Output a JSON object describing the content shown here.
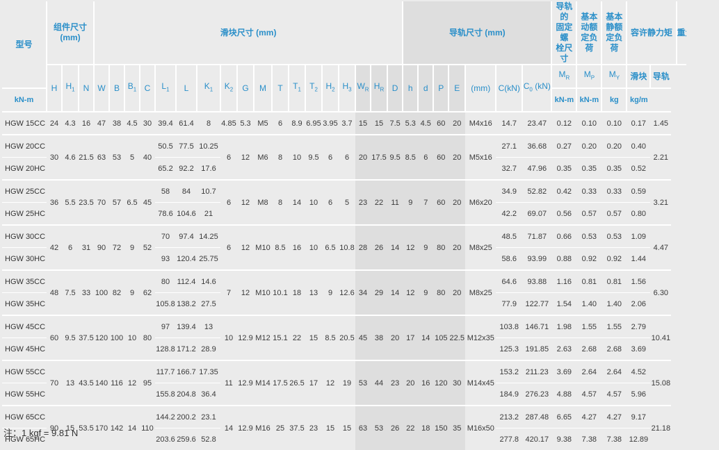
{
  "headers": {
    "model": "型号",
    "assembly": "组件尺寸\n(mm)",
    "block": "滑块尺寸 (mm)",
    "rail": "导轨尺寸 (mm)",
    "rail_bolt": "导轨的\n固定螺\n栓尺寸",
    "dynamic": "基本\n动额\n定负荷",
    "static": "基本\n静额\n定负荷",
    "moment": "容许静力矩",
    "weight": "重量",
    "mr": "MR",
    "mp": "MP",
    "my": "MY",
    "w_block": "滑块",
    "w_rail": "导轨"
  },
  "subheaders": {
    "H": "H",
    "H1": "H1",
    "N": "N",
    "W": "W",
    "B": "B",
    "B1": "B1",
    "C": "C",
    "L1": "L1",
    "L": "L",
    "K1": "K1",
    "K2": "K2",
    "G": "G",
    "M": "M",
    "T": "T",
    "T1": "T1",
    "T2": "T2",
    "H2": "H2",
    "H3": "H3",
    "WR": "WR",
    "HR": "HR",
    "D": "D",
    "h": "h",
    "d": "d",
    "P": "P",
    "E": "E",
    "mm": "(mm)",
    "ckn": "C(kN)",
    "c0kn": "C0 (kN)",
    "knm1": "kN-m",
    "knm2": "kN-m",
    "knm3": "kN-m",
    "kg": "kg",
    "kgm": "kg/m"
  },
  "rows": [
    {
      "model": "HGW 15CC"
    },
    {
      "model": "HGW 20CC"
    },
    {
      "model": "HGW 20HC"
    },
    {
      "model": "HGW 25CC"
    },
    {
      "model": "HGW 25HC"
    },
    {
      "model": "HGW 30CC"
    },
    {
      "model": "HGW 30HC"
    },
    {
      "model": "HGW 35CC"
    },
    {
      "model": "HGW 35HC"
    },
    {
      "model": "HGW 45CC"
    },
    {
      "model": "HGW 45HC"
    },
    {
      "model": "HGW 55CC"
    },
    {
      "model": "HGW 55HC"
    },
    {
      "model": "HGW 65CC"
    },
    {
      "model": "HGW 65HC"
    }
  ],
  "groups": [
    {
      "H": "24",
      "H1": "4.3",
      "N": "16",
      "W": "47",
      "B": "38",
      "B1": "4.5",
      "C": "30",
      "K2": "4.85",
      "G": "5.3",
      "M": "M5",
      "T": "6",
      "T1": "8.9",
      "T2": "6.95",
      "H2": "3.95",
      "H3": "3.7",
      "WR": "15",
      "HR": "15",
      "D": "7.5",
      "h": "5.3",
      "d": "4.5",
      "P": "60",
      "E": "20",
      "bolt": "M4x16",
      "w_rail": "1.45",
      "sub": [
        {
          "L1": "39.4",
          "L": "61.4",
          "K1": "8",
          "C": "14.7",
          "C0": "23.47",
          "MR": "0.12",
          "MP": "0.10",
          "MY": "0.10",
          "wb": "0.17"
        }
      ]
    },
    {
      "H": "30",
      "H1": "4.6",
      "N": "21.5",
      "W": "63",
      "B": "53",
      "B1": "5",
      "C": "40",
      "K2": "6",
      "G": "12",
      "M": "M6",
      "T": "8",
      "T1": "10",
      "T2": "9.5",
      "H2": "6",
      "H3": "6",
      "WR": "20",
      "HR": "17.5",
      "D": "9.5",
      "h": "8.5",
      "d": "6",
      "P": "60",
      "E": "20",
      "bolt": "M5x16",
      "w_rail": "2.21",
      "sub": [
        {
          "L1": "50.5",
          "L": "77.5",
          "K1": "10.25",
          "C": "27.1",
          "C0": "36.68",
          "MR": "0.27",
          "MP": "0.20",
          "MY": "0.20",
          "wb": "0.40"
        },
        {
          "L1": "65.2",
          "L": "92.2",
          "K1": "17.6",
          "C": "32.7",
          "C0": "47.96",
          "MR": "0.35",
          "MP": "0.35",
          "MY": "0.35",
          "wb": "0.52"
        }
      ]
    },
    {
      "H": "36",
      "H1": "5.5",
      "N": "23.5",
      "W": "70",
      "B": "57",
      "B1": "6.5",
      "C": "45",
      "K2": "6",
      "G": "12",
      "M": "M8",
      "T": "8",
      "T1": "14",
      "T2": "10",
      "H2": "6",
      "H3": "5",
      "WR": "23",
      "HR": "22",
      "D": "11",
      "h": "9",
      "d": "7",
      "P": "60",
      "E": "20",
      "bolt": "M6x20",
      "w_rail": "3.21",
      "sub": [
        {
          "L1": "58",
          "L": "84",
          "K1": "10.7",
          "C": "34.9",
          "C0": "52.82",
          "MR": "0.42",
          "MP": "0.33",
          "MY": "0.33",
          "wb": "0.59"
        },
        {
          "L1": "78.6",
          "L": "104.6",
          "K1": "21",
          "C": "42.2",
          "C0": "69.07",
          "MR": "0.56",
          "MP": "0.57",
          "MY": "0.57",
          "wb": "0.80"
        }
      ]
    },
    {
      "H": "42",
      "H1": "6",
      "N": "31",
      "W": "90",
      "B": "72",
      "B1": "9",
      "C": "52",
      "K2": "6",
      "G": "12",
      "M": "M10",
      "T": "8.5",
      "T1": "16",
      "T2": "10",
      "H2": "6.5",
      "H3": "10.8",
      "WR": "28",
      "HR": "26",
      "D": "14",
      "h": "12",
      "d": "9",
      "P": "80",
      "E": "20",
      "bolt": "M8x25",
      "w_rail": "4.47",
      "sub": [
        {
          "L1": "70",
          "L": "97.4",
          "K1": "14.25",
          "C": "48.5",
          "C0": "71.87",
          "MR": "0.66",
          "MP": "0.53",
          "MY": "0.53",
          "wb": "1.09"
        },
        {
          "L1": "93",
          "L": "120.4",
          "K1": "25.75",
          "C": "58.6",
          "C0": "93.99",
          "MR": "0.88",
          "MP": "0.92",
          "MY": "0.92",
          "wb": "1.44"
        }
      ]
    },
    {
      "H": "48",
      "H1": "7.5",
      "N": "33",
      "W": "100",
      "B": "82",
      "B1": "9",
      "C": "62",
      "K2": "7",
      "G": "12",
      "M": "M10",
      "T": "10.1",
      "T1": "18",
      "T2": "13",
      "H2": "9",
      "H3": "12.6",
      "WR": "34",
      "HR": "29",
      "D": "14",
      "h": "12",
      "d": "9",
      "P": "80",
      "E": "20",
      "bolt": "M8x25",
      "w_rail": "6.30",
      "sub": [
        {
          "L1": "80",
          "L": "112.4",
          "K1": "14.6",
          "C": "64.6",
          "C0": "93.88",
          "MR": "1.16",
          "MP": "0.81",
          "MY": "0.81",
          "wb": "1.56"
        },
        {
          "L1": "105.8",
          "L": "138.2",
          "K1": "27.5",
          "C": "77.9",
          "C0": "122.77",
          "MR": "1.54",
          "MP": "1.40",
          "MY": "1.40",
          "wb": "2.06"
        }
      ]
    },
    {
      "H": "60",
      "H1": "9.5",
      "N": "37.5",
      "W": "120",
      "B": "100",
      "B1": "10",
      "C": "80",
      "K2": "10",
      "G": "12.9",
      "M": "M12",
      "T": "15.1",
      "T1": "22",
      "T2": "15",
      "H2": "8.5",
      "H3": "20.5",
      "WR": "45",
      "HR": "38",
      "D": "20",
      "h": "17",
      "d": "14",
      "P": "105",
      "E": "22.5",
      "bolt": "M12x35",
      "w_rail": "10.41",
      "sub": [
        {
          "L1": "97",
          "L": "139.4",
          "K1": "13",
          "C": "103.8",
          "C0": "146.71",
          "MR": "1.98",
          "MP": "1.55",
          "MY": "1.55",
          "wb": "2.79"
        },
        {
          "L1": "128.8",
          "L": "171.2",
          "K1": "28.9",
          "C": "125.3",
          "C0": "191.85",
          "MR": "2.63",
          "MP": "2.68",
          "MY": "2.68",
          "wb": "3.69"
        }
      ]
    },
    {
      "H": "70",
      "H1": "13",
      "N": "43.5",
      "W": "140",
      "B": "116",
      "B1": "12",
      "C": "95",
      "K2": "11",
      "G": "12.9",
      "M": "M14",
      "T": "17.5",
      "T1": "26.5",
      "T2": "17",
      "H2": "12",
      "H3": "19",
      "WR": "53",
      "HR": "44",
      "D": "23",
      "h": "20",
      "d": "16",
      "P": "120",
      "E": "30",
      "bolt": "M14x45",
      "w_rail": "15.08",
      "sub": [
        {
          "L1": "117.7",
          "L": "166.7",
          "K1": "17.35",
          "C": "153.2",
          "C0": "211.23",
          "MR": "3.69",
          "MP": "2.64",
          "MY": "2.64",
          "wb": "4.52"
        },
        {
          "L1": "155.8",
          "L": "204.8",
          "K1": "36.4",
          "C": "184.9",
          "C0": "276.23",
          "MR": "4.88",
          "MP": "4.57",
          "MY": "4.57",
          "wb": "5.96"
        }
      ]
    },
    {
      "H": "90",
      "H1": "15",
      "N": "53.5",
      "W": "170",
      "B": "142",
      "B1": "14",
      "C": "110",
      "K2": "14",
      "G": "12.9",
      "M": "M16",
      "T": "25",
      "T1": "37.5",
      "T2": "23",
      "H2": "15",
      "H3": "15",
      "WR": "63",
      "HR": "53",
      "D": "26",
      "h": "22",
      "d": "18",
      "P": "150",
      "E": "35",
      "bolt": "M16x50",
      "w_rail": "21.18",
      "sub": [
        {
          "L1": "144.2",
          "L": "200.2",
          "K1": "23.1",
          "C": "213.2",
          "C0": "287.48",
          "MR": "6.65",
          "MP": "4.27",
          "MY": "4.27",
          "wb": "9.17"
        },
        {
          "L1": "203.6",
          "L": "259.6",
          "K1": "52.8",
          "C": "277.8",
          "C0": "420.17",
          "MR": "9.38",
          "MP": "7.38",
          "MY": "7.38",
          "wb": "12.89"
        }
      ]
    }
  ],
  "note": "注：1 kgf = 9.81 N"
}
